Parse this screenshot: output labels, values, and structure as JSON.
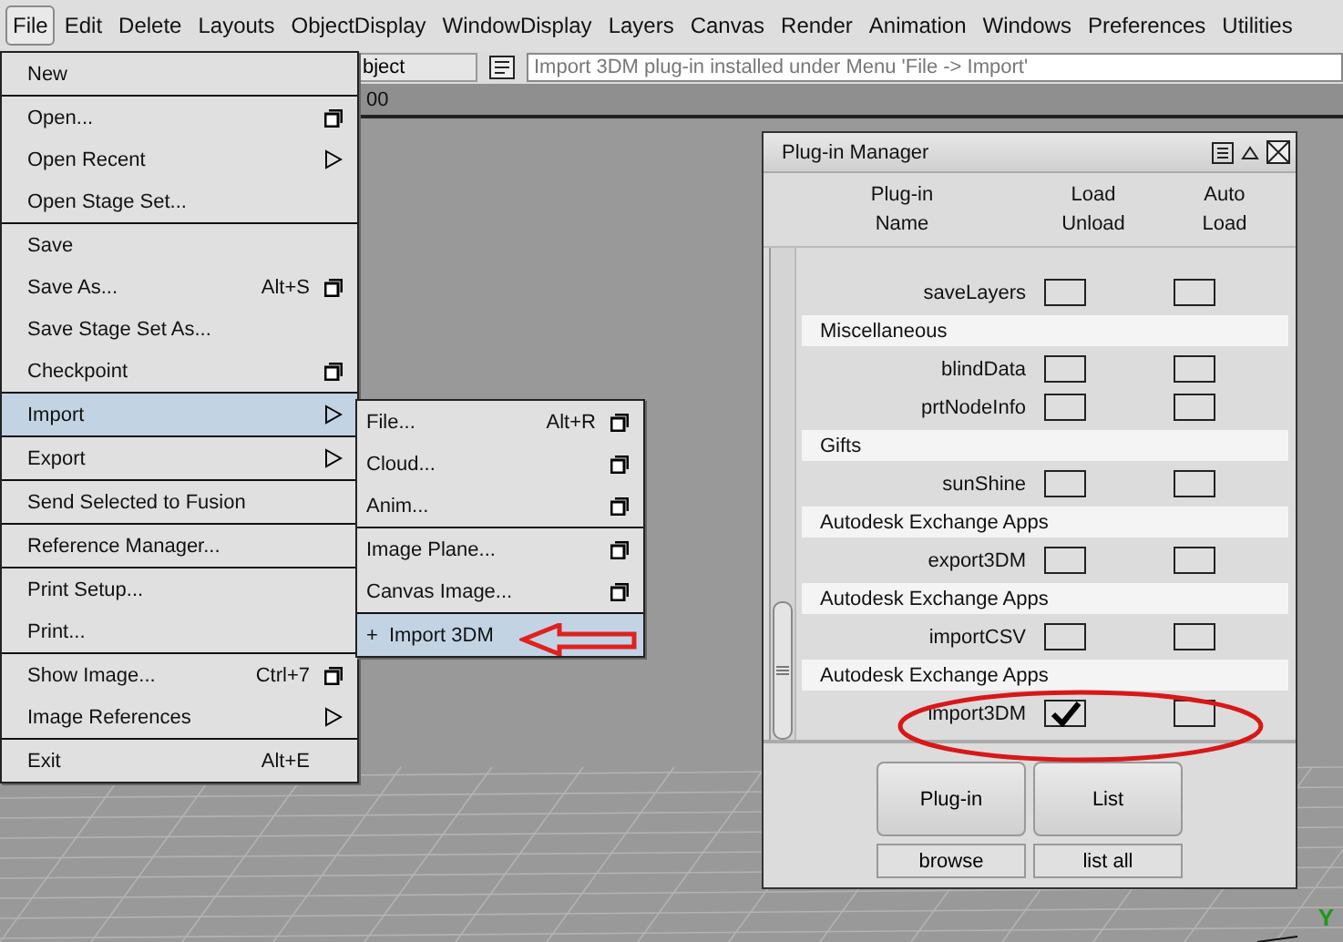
{
  "menu_bar": [
    {
      "label": "File",
      "selected": true
    },
    {
      "label": "Edit",
      "selected": false
    },
    {
      "label": "Delete",
      "selected": false
    },
    {
      "label": "Layouts",
      "selected": false
    },
    {
      "label": "ObjectDisplay",
      "selected": false
    },
    {
      "label": "WindowDisplay",
      "selected": false
    },
    {
      "label": "Layers",
      "selected": false
    },
    {
      "label": "Canvas",
      "selected": false
    },
    {
      "label": "Render",
      "selected": false
    },
    {
      "label": "Animation",
      "selected": false
    },
    {
      "label": "Windows",
      "selected": false
    },
    {
      "label": "Preferences",
      "selected": false
    },
    {
      "label": "Utilities",
      "selected": false
    }
  ],
  "toolbar": {
    "object_field": "bject",
    "feedback_field": "Import 3DM plug-in installed under Menu 'File -> Import'",
    "time_text": "00"
  },
  "file_menu": {
    "sections": [
      [
        {
          "label": "New",
          "option_box": false,
          "submenu": false,
          "selected": false
        }
      ],
      [
        {
          "label": "Open...",
          "option_box": true,
          "submenu": false,
          "selected": false
        },
        {
          "label": "Open Recent",
          "option_box": false,
          "submenu": true,
          "selected": false
        },
        {
          "label": "Open Stage Set...",
          "option_box": false,
          "submenu": false,
          "selected": false
        }
      ],
      [
        {
          "label": "Save",
          "option_box": false,
          "submenu": false,
          "selected": false
        },
        {
          "label": "Save As...",
          "shortcut": "Alt+S",
          "option_box": true,
          "submenu": false,
          "selected": false
        },
        {
          "label": "Save Stage Set As...",
          "option_box": false,
          "submenu": false,
          "selected": false
        },
        {
          "label": "Checkpoint",
          "option_box": true,
          "submenu": false,
          "selected": false
        }
      ],
      [
        {
          "label": "Import",
          "option_box": false,
          "submenu": true,
          "selected": true
        }
      ],
      [
        {
          "label": "Export",
          "option_box": false,
          "submenu": true,
          "selected": false
        }
      ],
      [
        {
          "label": "Send Selected to Fusion",
          "option_box": false,
          "submenu": false,
          "selected": false
        }
      ],
      [
        {
          "label": "Reference Manager...",
          "option_box": false,
          "submenu": false,
          "selected": false
        }
      ],
      [
        {
          "label": "Print Setup...",
          "option_box": false,
          "submenu": false,
          "selected": false
        },
        {
          "label": "Print...",
          "option_box": false,
          "submenu": false,
          "selected": false
        }
      ],
      [
        {
          "label": "Show Image...",
          "shortcut": "Ctrl+7",
          "option_box": true,
          "submenu": false,
          "selected": false
        },
        {
          "label": "Image References",
          "option_box": false,
          "submenu": true,
          "selected": false
        }
      ],
      [
        {
          "label": "Exit",
          "shortcut": "Alt+E",
          "option_box": false,
          "submenu": false,
          "selected": false
        }
      ]
    ]
  },
  "import_submenu": {
    "sections": [
      [
        {
          "label": "File...",
          "shortcut": "Alt+R",
          "option_box": true,
          "selected": false
        },
        {
          "label": "Cloud...",
          "option_box": true,
          "selected": false
        },
        {
          "label": "Anim...",
          "option_box": true,
          "selected": false
        }
      ],
      [
        {
          "label": "Image Plane...",
          "option_box": true,
          "selected": false
        },
        {
          "label": "Canvas Image...",
          "option_box": true,
          "selected": false
        }
      ],
      [
        {
          "label": "Import 3DM",
          "marker": "+",
          "option_box": false,
          "selected": true
        }
      ]
    ]
  },
  "plugin_manager": {
    "title": "Plug-in Manager",
    "columns": [
      [
        "Plug-in",
        "Name"
      ],
      [
        "Load",
        "Unload"
      ],
      [
        "Auto",
        "Load"
      ]
    ],
    "rows": [
      {
        "kind": "plugin",
        "name": "saveLayers",
        "loaded": false,
        "auto_load": false
      },
      {
        "kind": "group",
        "name": "Miscellaneous"
      },
      {
        "kind": "plugin",
        "name": "blindData",
        "loaded": false,
        "auto_load": false
      },
      {
        "kind": "plugin",
        "name": "prtNodeInfo",
        "loaded": false,
        "auto_load": false
      },
      {
        "kind": "group",
        "name": "Gifts"
      },
      {
        "kind": "plugin",
        "name": "sunShine",
        "loaded": false,
        "auto_load": false
      },
      {
        "kind": "group",
        "name": "Autodesk Exchange Apps"
      },
      {
        "kind": "plugin",
        "name": "export3DM",
        "loaded": false,
        "auto_load": false
      },
      {
        "kind": "group",
        "name": "Autodesk Exchange Apps"
      },
      {
        "kind": "plugin",
        "name": "importCSV",
        "loaded": false,
        "auto_load": false
      },
      {
        "kind": "group",
        "name": "Autodesk Exchange Apps"
      },
      {
        "kind": "plugin",
        "name": "import3DM",
        "loaded": true,
        "auto_load": false
      }
    ],
    "buttons": [
      [
        "Plug-in",
        "List"
      ],
      [
        "browse",
        "list all"
      ]
    ]
  },
  "viewport": {
    "axis_label": "Y"
  }
}
